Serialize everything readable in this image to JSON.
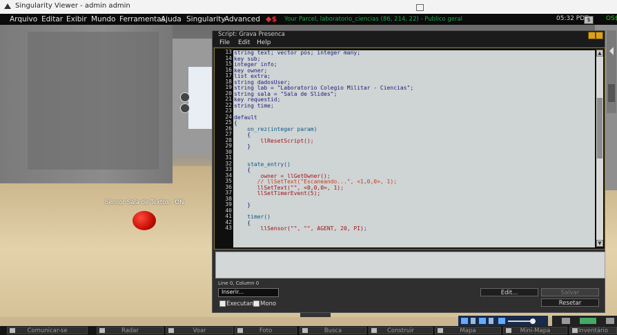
{
  "window": {
    "title": "Singularity Viewer - admin admin"
  },
  "menubar": {
    "items": [
      "Arquivo",
      "Editar",
      "Exibir",
      "Mundo",
      "Ferramentas",
      "Ajuda",
      "Singularity",
      "Advanced"
    ],
    "parcel": "Your Parcel, laboratorio_ciencias (86, 214, 22) - Publico geral",
    "time": "05:32 PDT",
    "balance": "OS$"
  },
  "scene": {
    "sensor_label": "Sensor Sala de Textos - ON"
  },
  "script_editor": {
    "title": "Script: Grava Presenca",
    "menu": [
      "File",
      "Edit",
      "Help"
    ],
    "line_numbers": [
      "13",
      "14",
      "15",
      "16",
      "17",
      "18",
      "19",
      "20",
      "21",
      "22",
      "23",
      "24",
      "25",
      "26",
      "27",
      "28",
      "29",
      "30",
      "31",
      "32",
      "33",
      "34",
      "35",
      "36",
      "37",
      "38",
      "39",
      "40",
      "41",
      "42",
      "43"
    ],
    "code_lines": [
      "string text; vector pos; integer many;",
      "key sub;",
      "integer info;",
      "key owner;",
      "list extra;",
      "string dadosUser;",
      "string lab = \"Laboratorio Colegio Militar - Ciencias\";",
      "string sala = \"Sala de Slides\";",
      "key requestid;",
      "string time;",
      "",
      "default",
      "{",
      "    on_rez(integer param)",
      "    {",
      "        llResetScript();",
      "    }",
      "",
      "",
      "    state_entry()",
      "    {",
      "        owner = llGetOwner();",
      "       // llSetText(\"Escaneando...\", <1,0,0>, 1);",
      "       llSetText(\"\", <0,0,0>, 1);",
      "       llSetTimerEvent(5);",
      "",
      "    }",
      "",
      "    timer()",
      "    {",
      "        llSensor(\"\", \"\", AGENT, 20, PI);"
    ],
    "status": "Line 0, Column 0",
    "insert_select": "Inserir...",
    "buttons": {
      "edit": "Edit...",
      "save": "Salvar",
      "reset": "Resetar"
    },
    "checkboxes": {
      "running": "Executanc",
      "mono": "Mono"
    }
  },
  "toolbar": {
    "items": [
      "Comunicar-se",
      "Radar",
      "Voar",
      "Foto",
      "Busca",
      "Construir",
      "Mapa",
      "Mini-Mapa",
      "Inventário"
    ]
  },
  "colors": {
    "accent": "#d9a21d",
    "parcel_text": "#1fa84a",
    "code_bg": "#cfd4d4",
    "editor_border": "#8a7a2a"
  }
}
